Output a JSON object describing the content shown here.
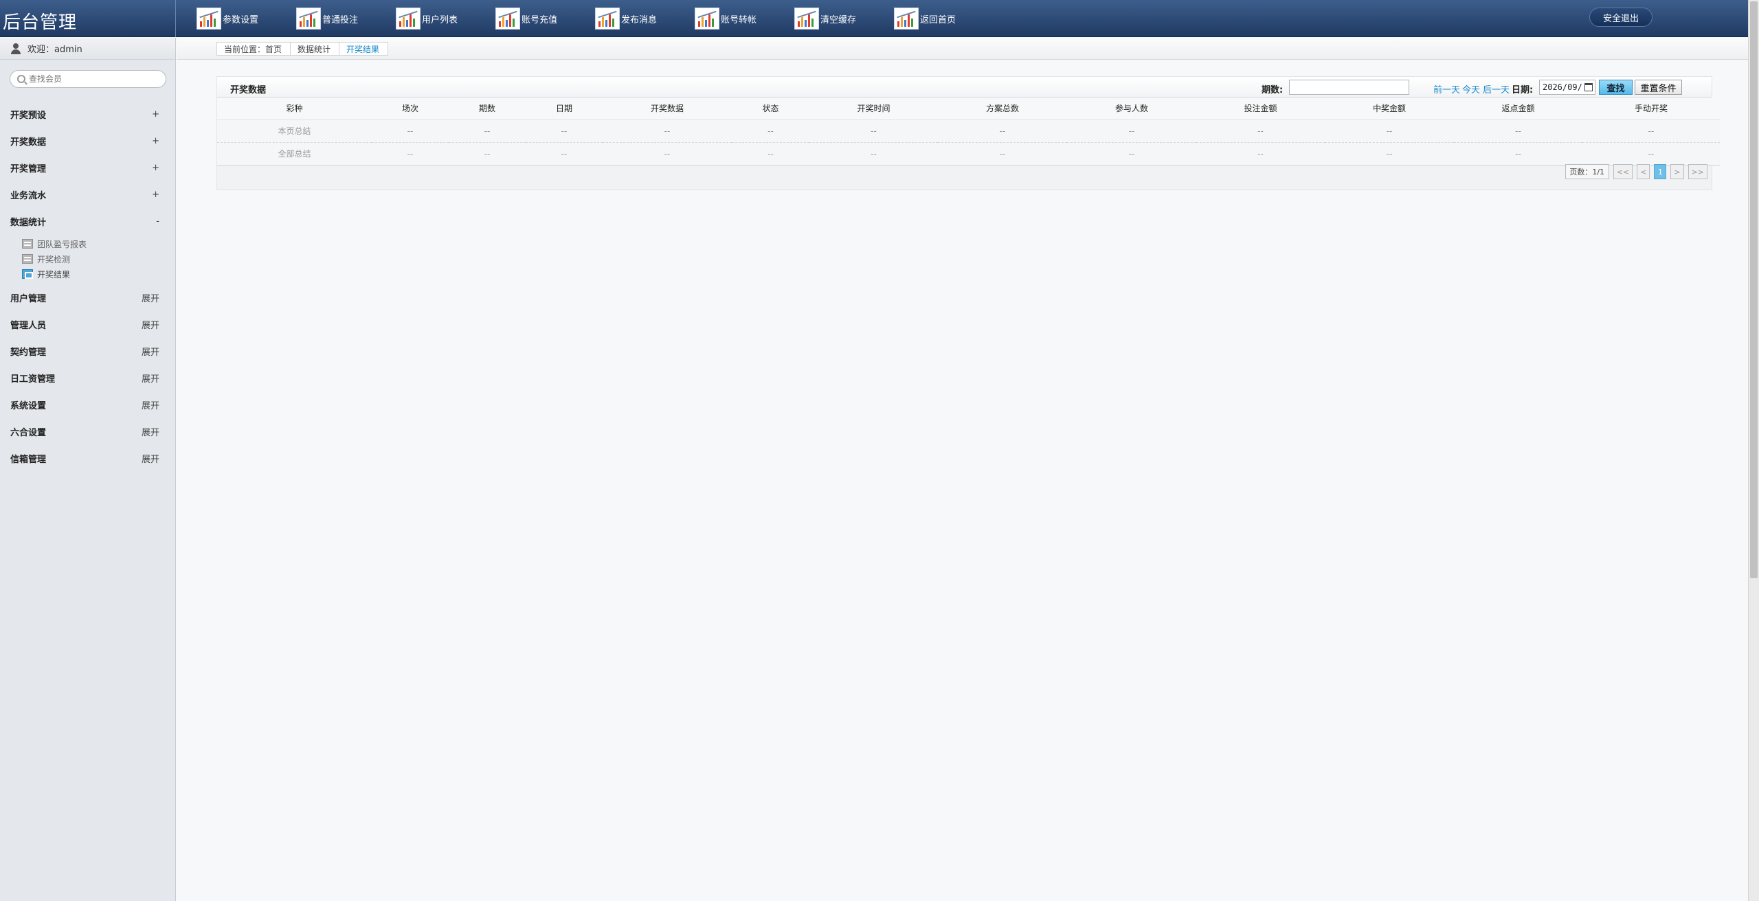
{
  "app": {
    "title": "后台管理"
  },
  "topnav": [
    {
      "label": "参数设置"
    },
    {
      "label": "普通投注"
    },
    {
      "label": "用户列表"
    },
    {
      "label": "账号充值"
    },
    {
      "label": "发布消息"
    },
    {
      "label": "账号转帐"
    },
    {
      "label": "清空缓存"
    },
    {
      "label": "返回首页"
    }
  ],
  "logout_label": "安全退出",
  "sidebar": {
    "welcome": "欢迎：admin",
    "search_placeholder": "查找会员",
    "menu": [
      {
        "label": "开奖预设",
        "toggle": "+"
      },
      {
        "label": "开奖数据",
        "toggle": "+"
      },
      {
        "label": "开奖管理",
        "toggle": "+"
      },
      {
        "label": "业务流水",
        "toggle": "+"
      },
      {
        "label": "数据统计",
        "toggle": "-"
      },
      {
        "label": "用户管理",
        "toggle": "展开"
      },
      {
        "label": "管理人员",
        "toggle": "展开"
      },
      {
        "label": "契约管理",
        "toggle": "展开"
      },
      {
        "label": "日工资管理",
        "toggle": "展开"
      },
      {
        "label": "系统设置",
        "toggle": "展开"
      },
      {
        "label": "六合设置",
        "toggle": "展开"
      },
      {
        "label": "信箱管理",
        "toggle": "展开"
      }
    ],
    "submenu": [
      {
        "label": "团队盈亏报表"
      },
      {
        "label": "开奖检测"
      },
      {
        "label": "开奖结果"
      }
    ]
  },
  "breadcrumb": {
    "location": "当前位置：首页",
    "section": "数据统计",
    "current": "开奖结果"
  },
  "panel": {
    "title": "开奖数据",
    "issue_label": "期数:",
    "issue_value": "",
    "prev_day": "前一天",
    "today": "今天",
    "next_day": "后一天",
    "date_label": "日期:",
    "date_value": "2026/09/",
    "search_label": "查找",
    "reset_label": "重置条件"
  },
  "table": {
    "columns": [
      "彩种",
      "场次",
      "期数",
      "日期",
      "开奖数据",
      "状态",
      "开奖时间",
      "方案总数",
      "参与人数",
      "投注金额",
      "中奖金额",
      "返点金额",
      "手动开奖"
    ],
    "rows": [
      [
        "本页总结",
        "--",
        "--",
        "--",
        "--",
        "--",
        "--",
        "--",
        "--",
        "--",
        "--",
        "--",
        "--"
      ],
      [
        "全部总结",
        "--",
        "--",
        "--",
        "--",
        "--",
        "--",
        "--",
        "--",
        "--",
        "--",
        "--",
        "--"
      ]
    ]
  },
  "pager": {
    "info": "页数：1/1",
    "first": "<<",
    "prev": "<",
    "current": "1",
    "next": ">",
    "last": ">>"
  }
}
